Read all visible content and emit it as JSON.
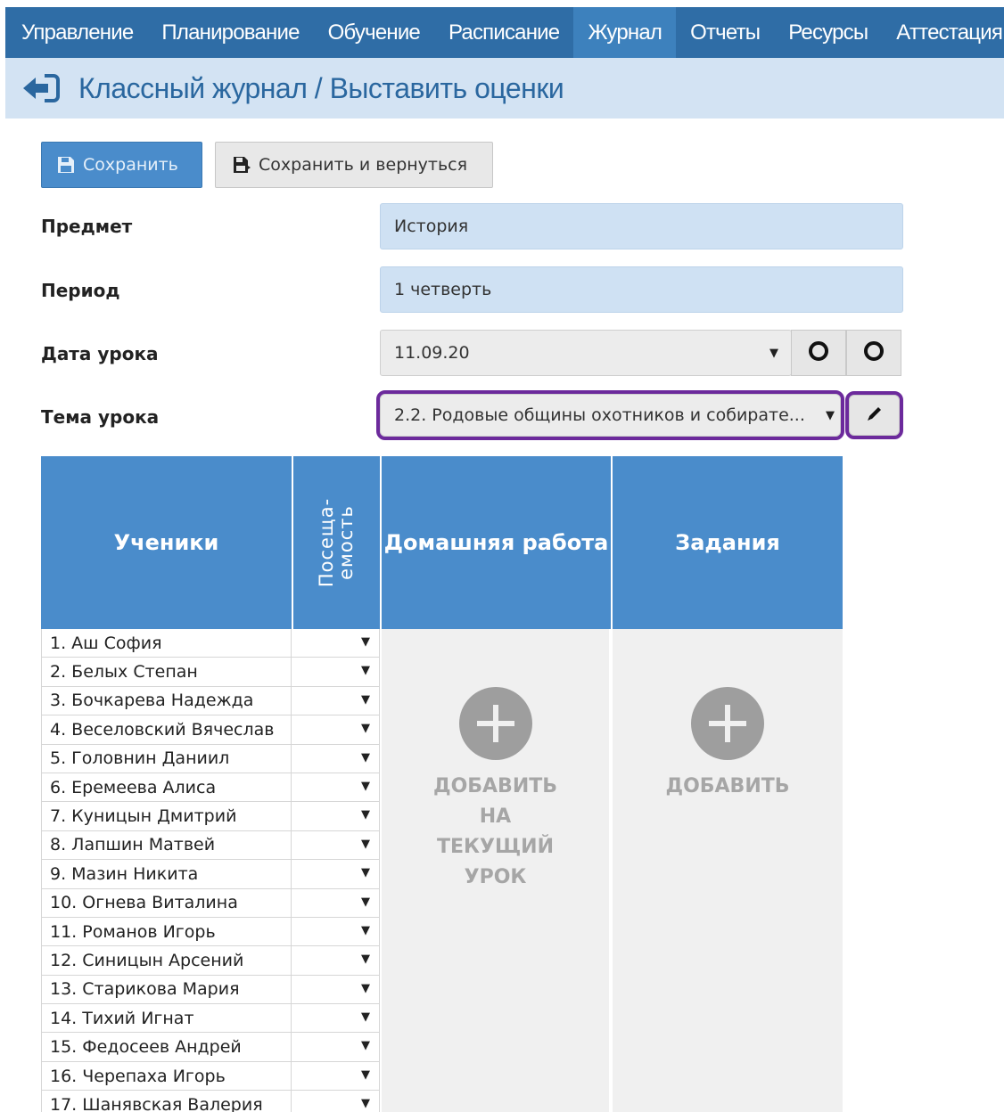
{
  "nav": {
    "items": [
      "Управление",
      "Планирование",
      "Обучение",
      "Расписание",
      "Журнал",
      "Отчеты",
      "Ресурсы",
      "Аттестация"
    ],
    "active": "Журнал"
  },
  "header": {
    "title": "Классный журнал / Выставить оценки"
  },
  "toolbar": {
    "save_label": "Сохранить",
    "save_return_label": "Сохранить и вернуться"
  },
  "form": {
    "subject_label": "Предмет",
    "subject_value": "История",
    "period_label": "Период",
    "period_value": "1 четверть",
    "date_label": "Дата урока",
    "date_value": "11.09.20",
    "topic_label": "Тема урока",
    "topic_value": "2.2. Родовые общины охотников и собирате..."
  },
  "table": {
    "headers": {
      "students": "Ученики",
      "attendance_line1": "Посеща-",
      "attendance_line2": "емость",
      "homework": "Домашняя работа",
      "tasks": "Задания"
    },
    "students": [
      "1. Аш София",
      "2. Белых Степан",
      "3. Бочкарева Надежда",
      "4. Веселовский Вячеслав",
      "5. Головнин Даниил",
      "6. Еремеева Алиса",
      "7. Куницын Дмитрий",
      "8. Лапшин Матвей",
      "9. Мазин Никита",
      "10. Огнева Виталина",
      "11. Романов Игорь",
      "12. Синицын Арсений",
      "13. Старикова Мария",
      "14. Тихий Игнат",
      "15. Федосеев Андрей",
      "16. Черепаха Игорь",
      "17. Шанявская Валерия"
    ],
    "homework_add_lines": [
      "ДОБАВИТЬ",
      "НА",
      "ТЕКУЩИЙ",
      "УРОК"
    ],
    "tasks_add_label": "ДОБАВИТЬ"
  },
  "colors": {
    "nav_bg": "#2f6da6",
    "nav_active": "#3d81bd",
    "header_bg": "#d3e3f3",
    "table_header": "#4a8ccb",
    "highlight": "#6c2a9c"
  }
}
